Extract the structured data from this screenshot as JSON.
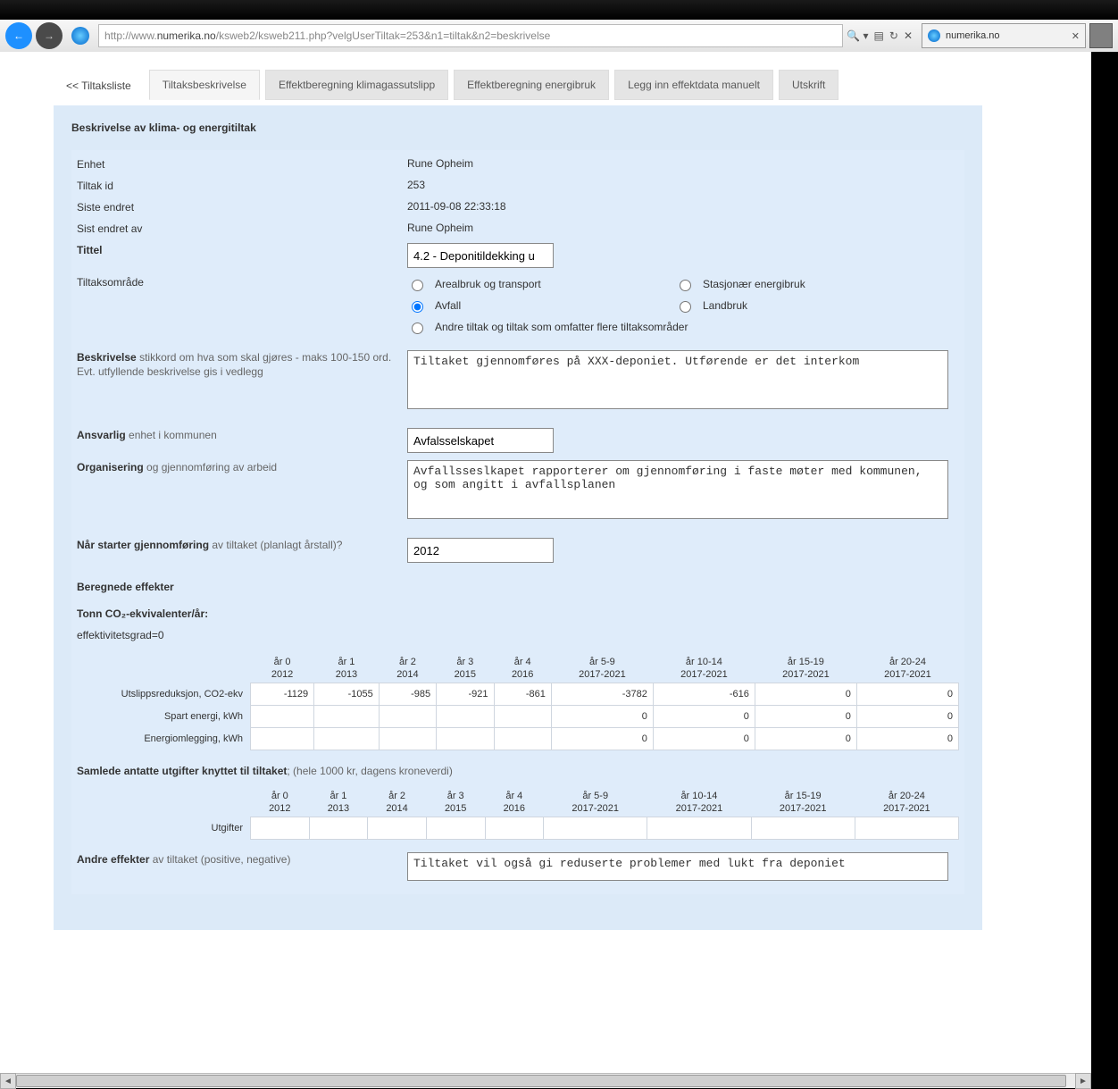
{
  "browser": {
    "url_prefix": "http://www.",
    "url_host": "numerika.no",
    "url_rest": "/ksweb2/ksweb211.php?velgUserTiltak=253&n1=tiltak&n2=beskrivelse",
    "tab_title": "numerika.no"
  },
  "tabs": {
    "tiltaksliste": "<< Tiltaksliste",
    "beskrivelse": "Tiltaksbeskrivelse",
    "effekt_klima": "Effektberegning klimagassutslipp",
    "effekt_energi": "Effektberegning energibruk",
    "legg_inn": "Legg inn effektdata manuelt",
    "utskrift": "Utskrift"
  },
  "heading": "Beskrivelse av klima- og energitiltak",
  "labels": {
    "enhet": "Enhet",
    "tiltak_id": "Tiltak id",
    "siste_endret": "Siste endret",
    "sist_endret_av": "Sist endret av",
    "tittel": "Tittel",
    "tiltaks_omrade": "Tiltaksområde",
    "beskrivelse_b": "Beskrivelse",
    "beskrivelse_help": " stikkord om hva som skal gjøres - maks 100-150 ord. Evt. utfyllende beskrivelse gis i vedlegg",
    "ansvarlig_b": "Ansvarlig",
    "ansvarlig_help": " enhet i kommunen",
    "organisering_b": "Organisering",
    "organisering_help": " og gjennomføring av arbeid",
    "start_b": "Når starter gjennomføring",
    "start_help": " av tiltaket (planlagt årstall)?",
    "beregnede": "Beregnede effekter",
    "tonn_co2": "Tonn CO₂-ekvivalenter/år:",
    "eff_grad": "effektivitetsgrad=0",
    "samlede_b": "Samlede antatte utgifter knyttet til tiltaket",
    "samlede_help": "; (hele 1000 kr, dagens kroneverdi)",
    "utgifter": "Utgifter",
    "andre_b": "Andre effekter",
    "andre_help": " av tiltaket (positive, negative)"
  },
  "values": {
    "enhet": "Rune Opheim",
    "tiltak_id": "253",
    "siste_endret": "2011-09-08 22:33:18",
    "sist_endret_av": "Rune Opheim",
    "tittel_input": "4.2 - Deponitildekking u",
    "beskrivelse_ta": "Tiltaket gjennomføres på XXX-deponiet. Utførende er det interkom",
    "ansvarlig_input": "Avfalsselskapet",
    "organisering_ta": "Avfallsseslkapet rapporterer om gjennomføring i faste møter med kommunen, og som angitt i avfallsplanen",
    "start_input": "2012",
    "andre_ta": "Tiltaket vil også gi reduserte problemer med lukt fra deponiet"
  },
  "radios": {
    "arealbruk": "Arealbruk og transport",
    "stasjonaer": "Stasjonær energibruk",
    "avfall": "Avfall",
    "landbruk": "Landbruk",
    "andre": "Andre tiltak og tiltak som omfatter flere tiltaksområder"
  },
  "eff_table": {
    "headers": [
      {
        "a": "år 0",
        "b": "2012"
      },
      {
        "a": "år 1",
        "b": "2013"
      },
      {
        "a": "år 2",
        "b": "2014"
      },
      {
        "a": "år 3",
        "b": "2015"
      },
      {
        "a": "år 4",
        "b": "2016"
      },
      {
        "a": "år 5-9",
        "b": "2017-2021"
      },
      {
        "a": "år 10-14",
        "b": "2017-2021"
      },
      {
        "a": "år 15-19",
        "b": "2017-2021"
      },
      {
        "a": "år 20-24",
        "b": "2017-2021"
      }
    ],
    "rows": [
      {
        "label": "Utslippsreduksjon, CO2-ekv",
        "cells": [
          "-1129",
          "-1055",
          "-985",
          "-921",
          "-861",
          "-3782",
          "-616",
          "0",
          "0"
        ]
      },
      {
        "label": "Spart energi, kWh",
        "cells": [
          "",
          "",
          "",
          "",
          "",
          "0",
          "0",
          "0",
          "0"
        ]
      },
      {
        "label": "Energiomlegging, kWh",
        "cells": [
          "",
          "",
          "",
          "",
          "",
          "0",
          "0",
          "0",
          "0"
        ]
      }
    ]
  },
  "utg_table": {
    "row_label": "Utgifter",
    "cells": [
      "",
      "",
      "",
      "",
      "",
      "",
      "",
      "",
      ""
    ]
  }
}
